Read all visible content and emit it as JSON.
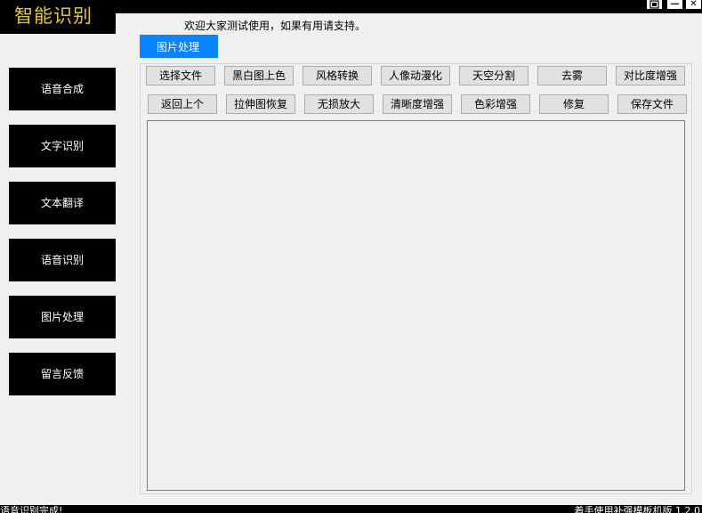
{
  "app": {
    "logo_text": "智能识别",
    "window_controls": {
      "icon": "window-icon",
      "minimize": "—",
      "close": "✕"
    }
  },
  "header": {
    "welcome": "欢迎大家测试使用，如果有用请支持。",
    "active_tab": "图片处理"
  },
  "sidebar": {
    "items": [
      {
        "label": "语音合成"
      },
      {
        "label": "文字识别"
      },
      {
        "label": "文本翻译"
      },
      {
        "label": "语音识别"
      },
      {
        "label": "图片处理"
      },
      {
        "label": "留言反馈"
      }
    ]
  },
  "toolbar": {
    "row1": [
      "选择文件",
      "黑白图上色",
      "风格转换",
      "人像动漫化",
      "天空分割",
      "去雾",
      "对比度增强"
    ],
    "row2": [
      "返回上个",
      "拉伸图恢复",
      "无损放大",
      "清晰度增强",
      "色彩增强",
      "修复",
      "保存文件"
    ]
  },
  "status": {
    "left": "语音识别完成!",
    "right": "着手使用补强模板机版 1.2.0"
  },
  "colors": {
    "accent": "#0a84ff",
    "logo": "#e3c93c",
    "sidebar_bg": "#000000"
  }
}
